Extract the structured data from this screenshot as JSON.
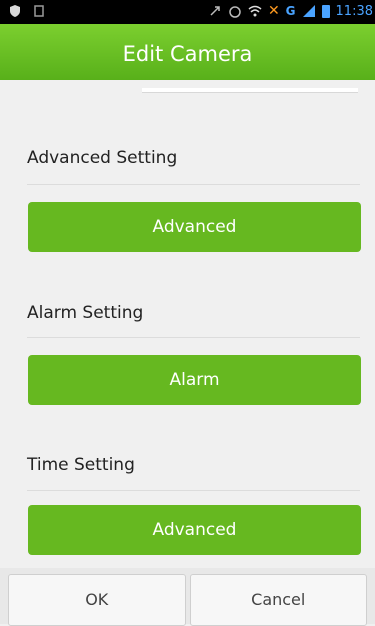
{
  "status_bar": {
    "time": "11:38",
    "network": "G",
    "icons_left": [
      "shield-icon",
      "sim-icon"
    ],
    "icons_right": [
      "usb-icon",
      "alarm-icon",
      "wifi-icon",
      "no-signal-icon",
      "signal-icon",
      "battery-icon"
    ]
  },
  "title_bar": {
    "title": "Edit Camera"
  },
  "sections": [
    {
      "label": "Advanced Setting",
      "button": "Advanced"
    },
    {
      "label": "Alarm Setting",
      "button": "Alarm"
    },
    {
      "label": "Time Setting",
      "button": "Advanced"
    }
  ],
  "footer": {
    "ok": "OK",
    "cancel": "Cancel"
  },
  "colors": {
    "accent": "#66b820",
    "title_bar": "#6ac026"
  }
}
